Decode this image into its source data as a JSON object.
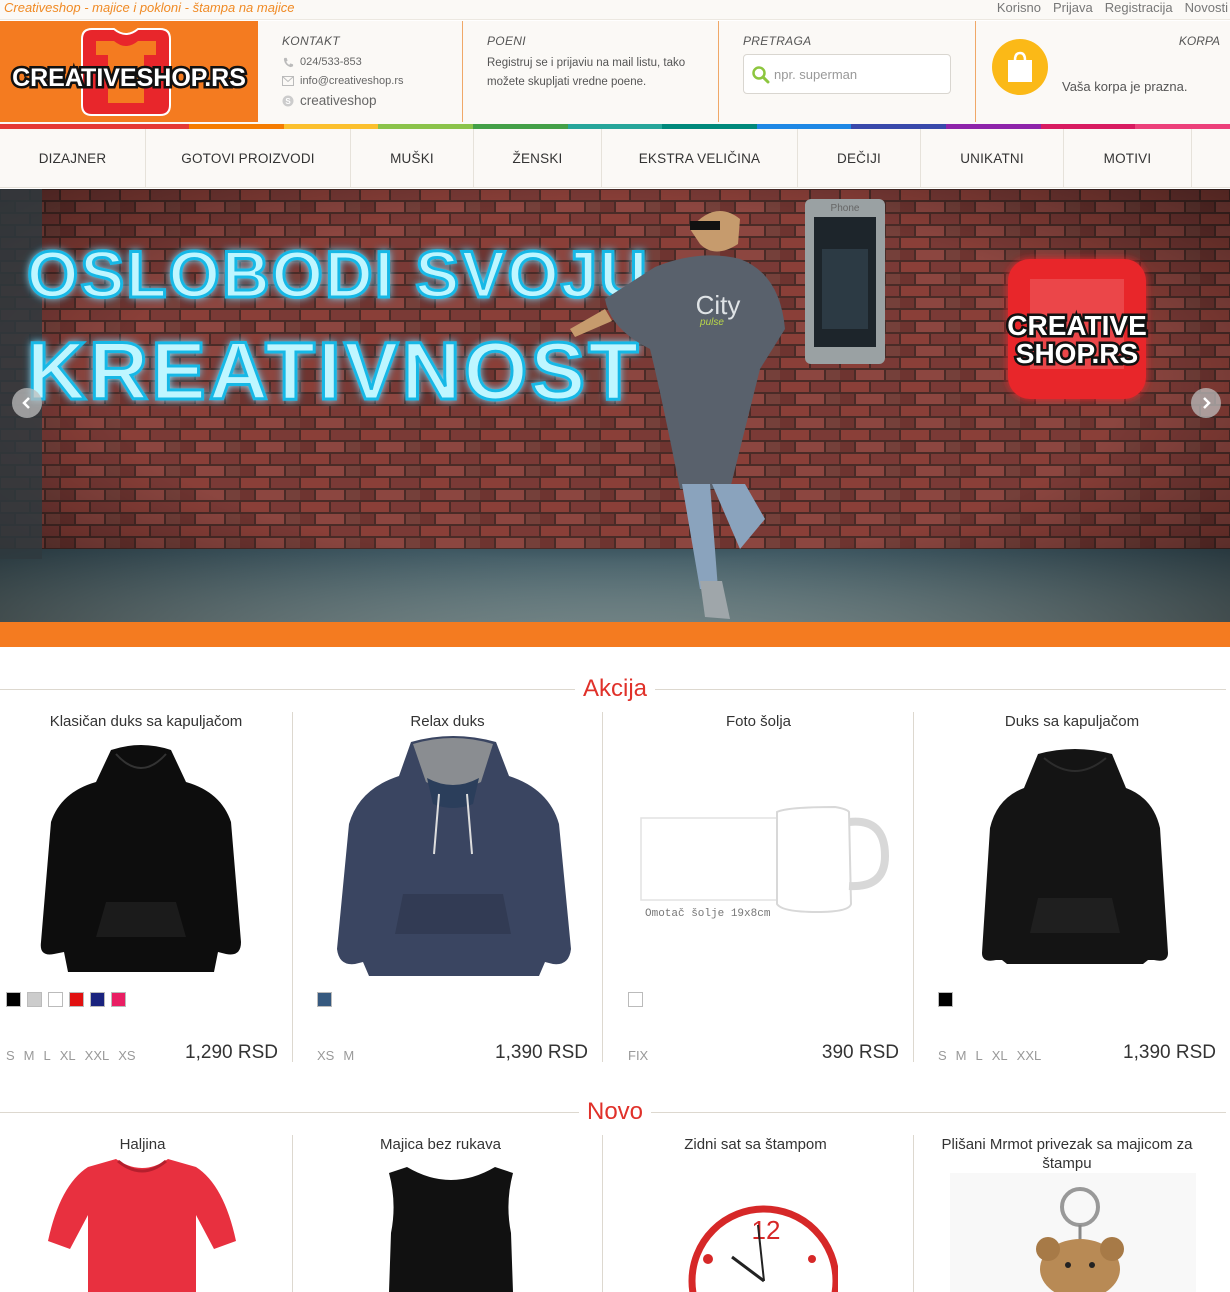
{
  "top": {
    "tagline": "Creativeshop - majice i pokloni - štampa na majice",
    "links": [
      "Korisno",
      "Prijava",
      "Registracija",
      "Novosti"
    ]
  },
  "logo": {
    "text": "CREATIVESHOP.RS"
  },
  "contact": {
    "label": "KONTAKT",
    "phone": "024/533-853",
    "email": "info@creativeshop.rs",
    "skype": "creativeshop"
  },
  "points": {
    "label": "POENI",
    "text": "Registruj se i prijaviu na mail listu, tako možete skupljati vredne poene."
  },
  "search": {
    "label": "PRETRAGA",
    "placeholder": "npr. superman"
  },
  "cart": {
    "label": "KORPA",
    "text": "Vaša korpa je prazna."
  },
  "nav": [
    "DIZAJNER",
    "GOTOVI PROIZVODI",
    "MUŠKI",
    "ŽENSKI",
    "EKSTRA VELIČINA",
    "DEČIJI",
    "UNIKATNI",
    "MOTIVI"
  ],
  "nav_colors": [
    "#e53935",
    "#e53935",
    "#f57c00",
    "#fbc02d",
    "#8bc34a",
    "#43a047",
    "#26a69a",
    "#00897b",
    "#1e88e5",
    "#3949ab",
    "#8e24aa",
    "#d81b60",
    "#ec407a"
  ],
  "banner": {
    "line1": "OSLOBODI SVOJU",
    "line2": "KREATIVNOST",
    "logo_line1": "CREATIVE",
    "logo_line2": "SHOP.RS",
    "shirt_text": "City",
    "shirt_sub": "pulse",
    "phone_label": "Phone"
  },
  "sale": {
    "title": "Akcija",
    "products": [
      {
        "name": "Klasičan duks sa kapuljačom",
        "colors": [
          "#000000",
          "#cccccc",
          "#ffffff",
          "#e11010",
          "#1a237e",
          "#e91e63"
        ],
        "sizes": [
          "S",
          "M",
          "L",
          "XL",
          "XXL",
          "XS"
        ],
        "price": "1,290 RSD"
      },
      {
        "name": "Relax duks",
        "colors": [
          "#36597f"
        ],
        "sizes": [
          "XS",
          "M"
        ],
        "price": "1,390 RSD"
      },
      {
        "name": "Foto šolja",
        "colors": [
          "#ffffff"
        ],
        "sizes": [
          "FIX"
        ],
        "price": "390 RSD",
        "caption": "Omotač šolje 19x8cm"
      },
      {
        "name": "Duks sa kapuljačom",
        "colors": [
          "#000000"
        ],
        "sizes": [
          "S",
          "M",
          "L",
          "XL",
          "XXL"
        ],
        "price": "1,390 RSD"
      }
    ]
  },
  "new": {
    "title": "Novo",
    "products": [
      {
        "name": "Haljina"
      },
      {
        "name": "Majica bez rukava"
      },
      {
        "name": "Zidni sat sa štampom"
      },
      {
        "name": "Plišani Mrmot privezak sa majicom za štampu"
      }
    ]
  }
}
